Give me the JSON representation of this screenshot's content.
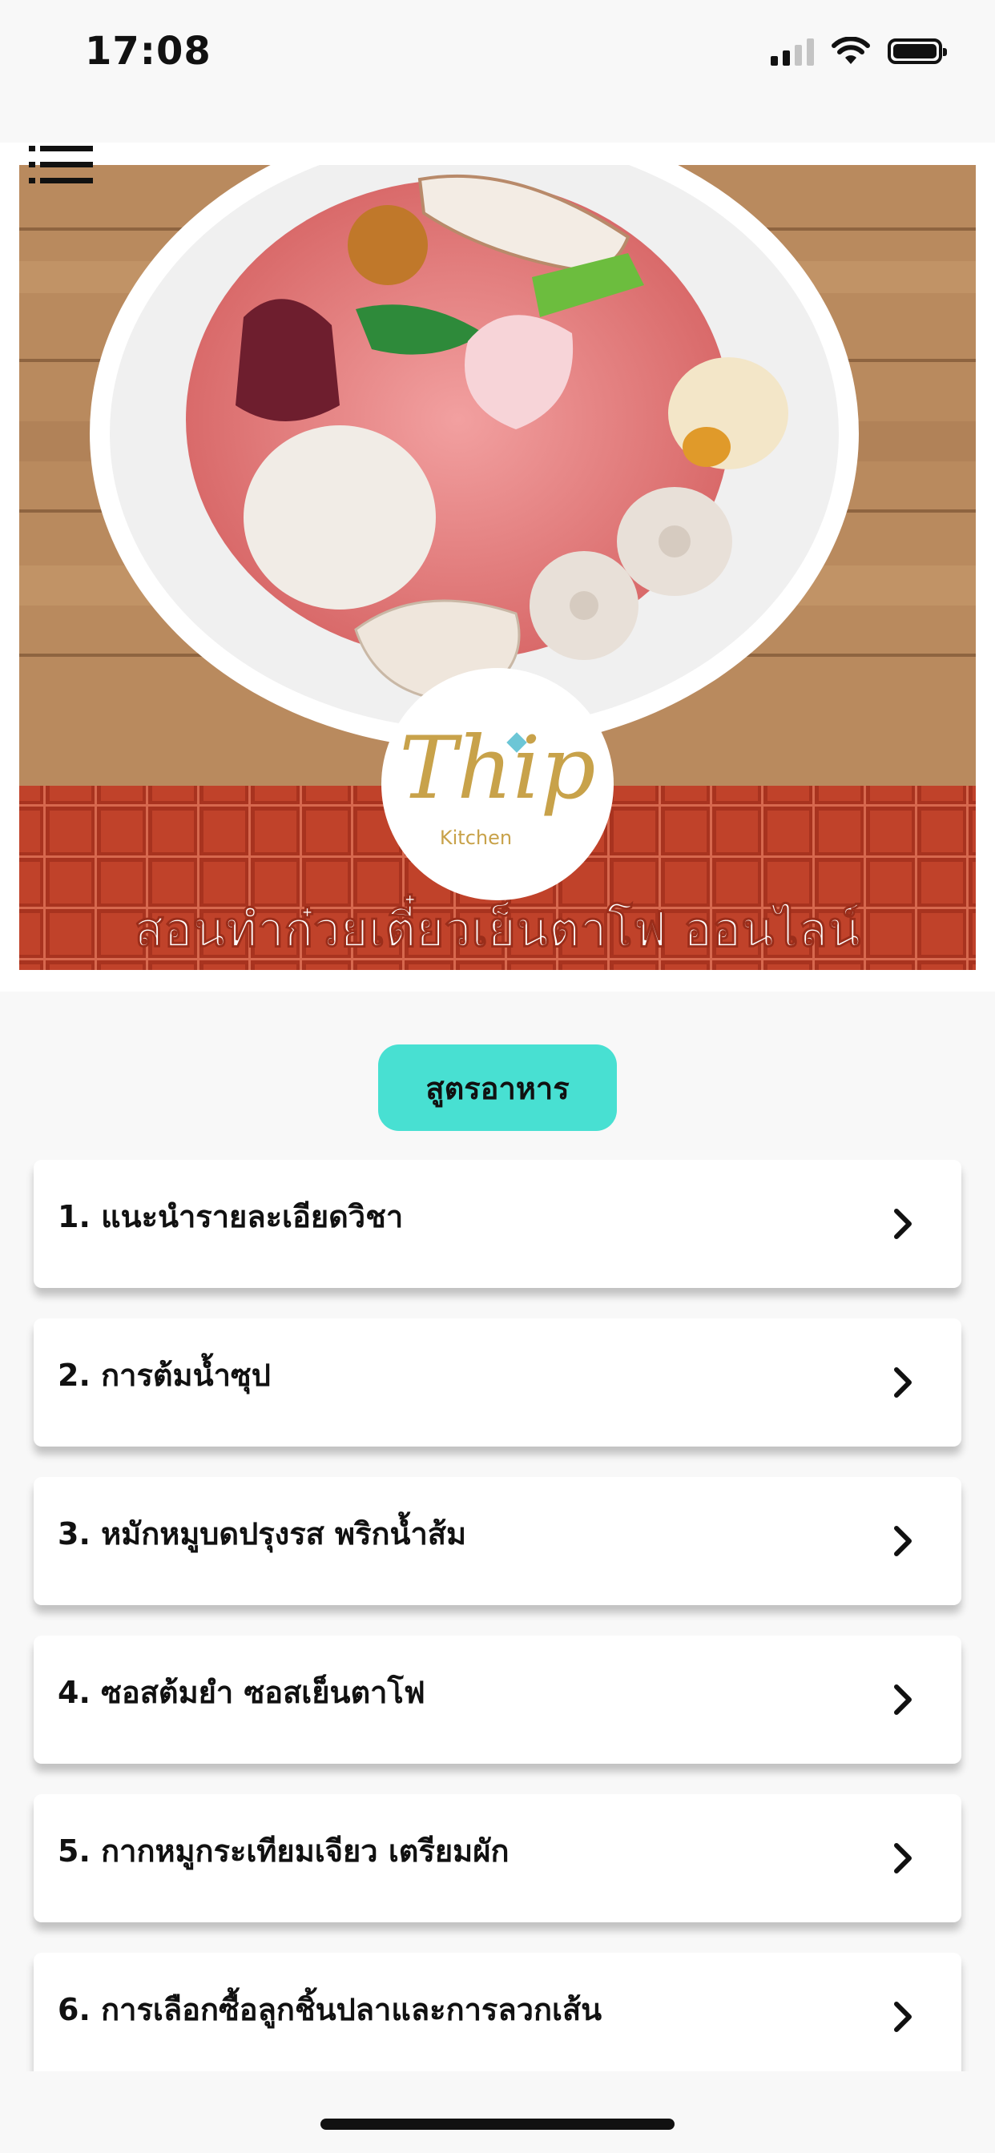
{
  "status_bar": {
    "time": "17:08",
    "signal_icon": "cellular-signal-icon",
    "wifi_icon": "wifi-icon",
    "battery_icon": "battery-icon"
  },
  "header": {
    "menu_icon": "list-menu-icon"
  },
  "hero": {
    "banner_text": "สอนทำก๋วยเตี๋ยวเย็นตาโฟ ออนไลน์",
    "logo_main": "Thip",
    "logo_sub": "Kitchen",
    "colors": {
      "plaid": "#c0422a",
      "wood": "#b98a5e"
    }
  },
  "category_button": {
    "label": "สูตรอาหาร",
    "color": "#48e0d2"
  },
  "lessons": [
    {
      "label": "1. แนะนำรายละเอียดวิชา"
    },
    {
      "label": "2. การต้มน้ำซุป"
    },
    {
      "label": "3. หมักหมูบดปรุงรส พริกน้ำส้ม"
    },
    {
      "label": "4. ซอสต้มยำ ซอสเย็นตาโฟ"
    },
    {
      "label": "5. กากหมูกระเทียมเจียว เตรียมผัก"
    },
    {
      "label": "6. การเลือกซื้อลูกชิ้นปลาและการลวกเส้น"
    }
  ]
}
